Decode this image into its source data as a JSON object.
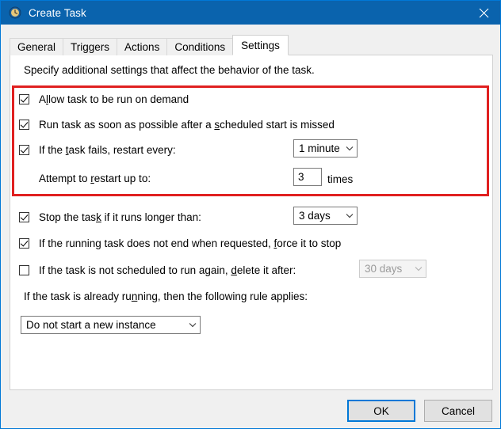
{
  "window": {
    "title": "Create Task",
    "icon": "clock-icon",
    "close_label": "✕",
    "accent_color": "#0a63ad",
    "highlight_color": "#e02020",
    "focus_color": "#0078d7"
  },
  "tabs": [
    {
      "label": "General",
      "active": false
    },
    {
      "label": "Triggers",
      "active": false
    },
    {
      "label": "Actions",
      "active": false
    },
    {
      "label": "Conditions",
      "active": false
    },
    {
      "label": "Settings",
      "active": true
    }
  ],
  "panel": {
    "intro": "Specify additional settings that affect the behavior of the task.",
    "settings": [
      {
        "id": "allow-on-demand",
        "checked": true,
        "enabled": true,
        "label_pre": "A",
        "label_accel": "l",
        "label_post": "low task to be run on demand"
      },
      {
        "id": "run-after-missed-start",
        "checked": true,
        "enabled": true,
        "label_pre": "Run task as soon as possible after a ",
        "label_accel": "s",
        "label_post": "cheduled start is missed"
      },
      {
        "id": "restart-on-failure",
        "checked": true,
        "enabled": true,
        "label_pre": "If the ",
        "label_accel": "t",
        "label_post": "ask fails, restart every:",
        "control": {
          "type": "combobox",
          "value": "1 minute",
          "enabled": true
        }
      },
      {
        "id": "restart-attempts",
        "checkbox": false,
        "label_pre": "Attempt to ",
        "label_accel": "r",
        "label_post": "estart up to:",
        "control": {
          "type": "textbox",
          "value": "3",
          "enabled": true
        },
        "unit": "times"
      },
      {
        "id": "stop-if-runs-longer",
        "checked": true,
        "enabled": true,
        "label_pre": "Stop the tas",
        "label_accel": "k",
        "label_post": " if it runs longer than:",
        "control": {
          "type": "combobox",
          "value": "3 days",
          "enabled": true
        }
      },
      {
        "id": "force-stop-if-not-ending",
        "checked": true,
        "enabled": true,
        "label_pre": "If the running task does not end when requested, ",
        "label_accel": "f",
        "label_post": "orce it to stop"
      },
      {
        "id": "delete-if-not-scheduled",
        "checked": false,
        "enabled": true,
        "label_pre": "If the task is not scheduled to run again, ",
        "label_accel": "d",
        "label_post": "elete it after:",
        "control": {
          "type": "combobox",
          "value": "30 days",
          "enabled": false
        }
      }
    ],
    "rule_label_pre": "If the task is already ru",
    "rule_label_accel": "n",
    "rule_label_post": "ning, then the following rule applies:",
    "rule_value": "Do not start a new instance"
  },
  "footer": {
    "ok_label": "OK",
    "cancel_label": "Cancel"
  }
}
